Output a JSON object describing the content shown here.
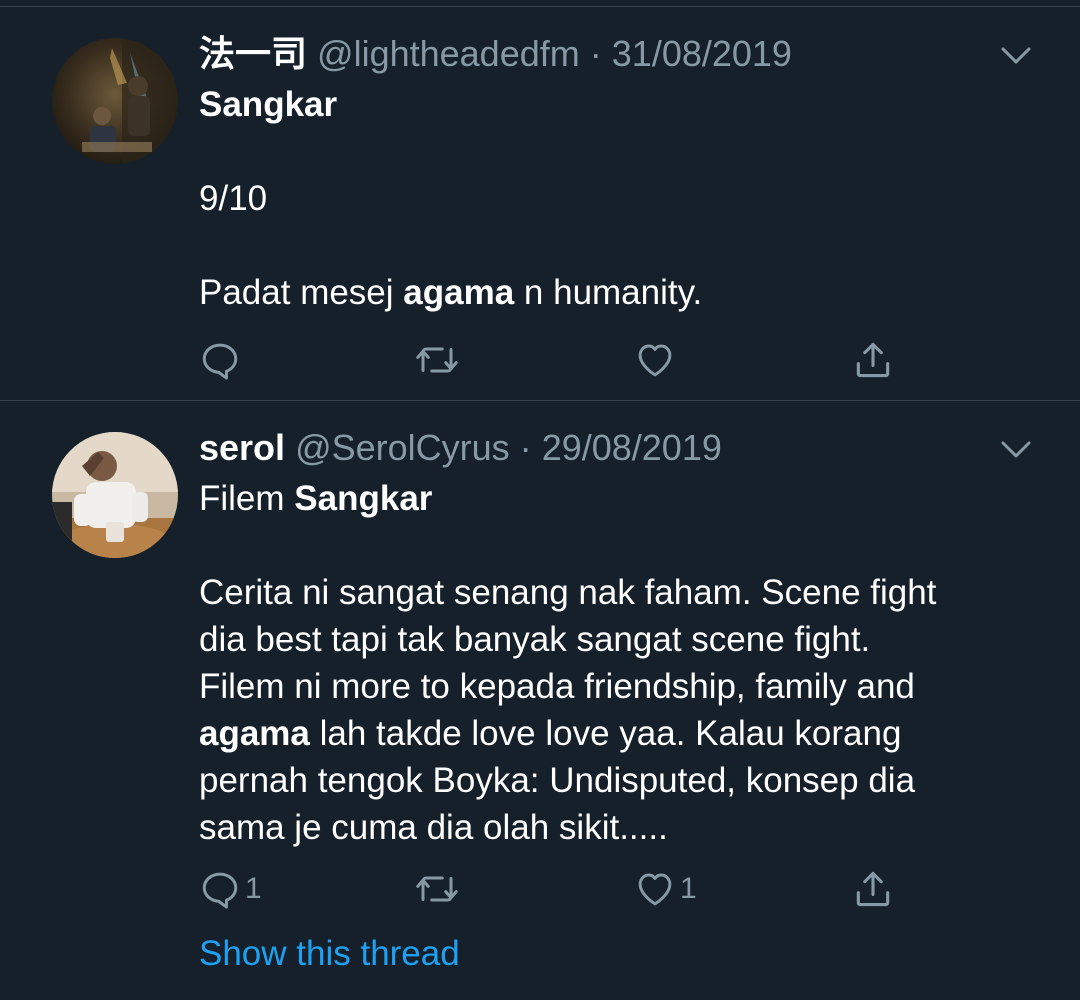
{
  "tweets": [
    {
      "display_name": "法一司",
      "handle": "@lightheadedfm",
      "separator": "·",
      "date": "31/08/2019",
      "body_lines": [
        [
          {
            "t": "Sangkar",
            "b": true
          }
        ],
        [],
        [
          {
            "t": "9/10",
            "b": false
          }
        ],
        [],
        [
          {
            "t": "Padat mesej ",
            "b": false
          },
          {
            "t": "agama",
            "b": true
          },
          {
            "t": " n humanity.",
            "b": false
          }
        ]
      ],
      "reply_count": "",
      "like_count": ""
    },
    {
      "display_name": "serol",
      "handle": "@SerolCyrus",
      "separator": "·",
      "date": "29/08/2019",
      "body_lines": [
        [
          {
            "t": "Filem ",
            "b": false
          },
          {
            "t": "Sangkar",
            "b": true
          }
        ],
        [],
        [
          {
            "t": "Cerita ni sangat senang nak faham. Scene fight",
            "b": false
          }
        ],
        [
          {
            "t": "dia best tapi tak banyak sangat scene fight.",
            "b": false
          }
        ],
        [
          {
            "t": "Filem ni more to kepada friendship, family and",
            "b": false
          }
        ],
        [
          {
            "t": "agama",
            "b": true
          },
          {
            "t": " lah takde love love yaa. Kalau korang",
            "b": false
          }
        ],
        [
          {
            "t": "pernah tengok Boyka: Undisputed, konsep dia",
            "b": false
          }
        ],
        [
          {
            "t": "sama je cuma dia olah sikit.....",
            "b": false
          }
        ]
      ],
      "reply_count": "1",
      "like_count": "1",
      "show_thread": "Show this thread"
    }
  ],
  "icons": {
    "reply": "reply-icon",
    "retweet": "retweet-icon",
    "like": "like-icon",
    "share": "share-icon",
    "more": "chevron-down-icon"
  },
  "colors": {
    "background": "#15202b",
    "divider": "#38444d",
    "secondary_text": "#8899a6",
    "link": "#1da1f2"
  }
}
